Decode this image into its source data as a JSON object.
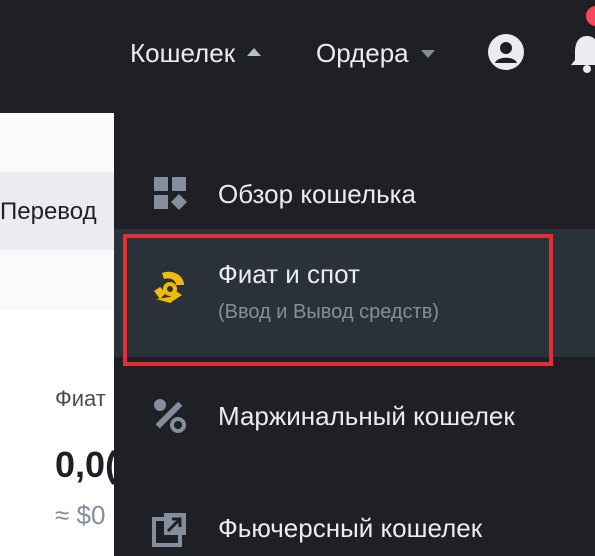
{
  "nav": {
    "wallet_label": "Кошелек",
    "orders_label": "Ордера"
  },
  "background": {
    "transfer_label": "Перевод",
    "fiat_label_partial": "Фиат",
    "amount_partial": "0,0(",
    "approx_partial": "≈ $0"
  },
  "dropdown": {
    "items": [
      {
        "label": "Обзор кошелька",
        "icon": "wallet-overview-icon"
      },
      {
        "label": "Фиат и спот",
        "sub": "(Ввод и Вывод средств)",
        "icon": "fiat-spot-icon"
      },
      {
        "label": "Маржинальный кошелек",
        "icon": "margin-percent-icon"
      },
      {
        "label": "Фьючерсный кошелек",
        "icon": "futures-icon"
      }
    ]
  },
  "colors": {
    "topbar_bg": "#1e2026",
    "menu_bg": "#1e2026",
    "menu_hover_bg": "#2b3139",
    "accent_yellow": "#f0b90b",
    "highlight_red": "#e02f37",
    "notification_dot": "#f6465d"
  }
}
